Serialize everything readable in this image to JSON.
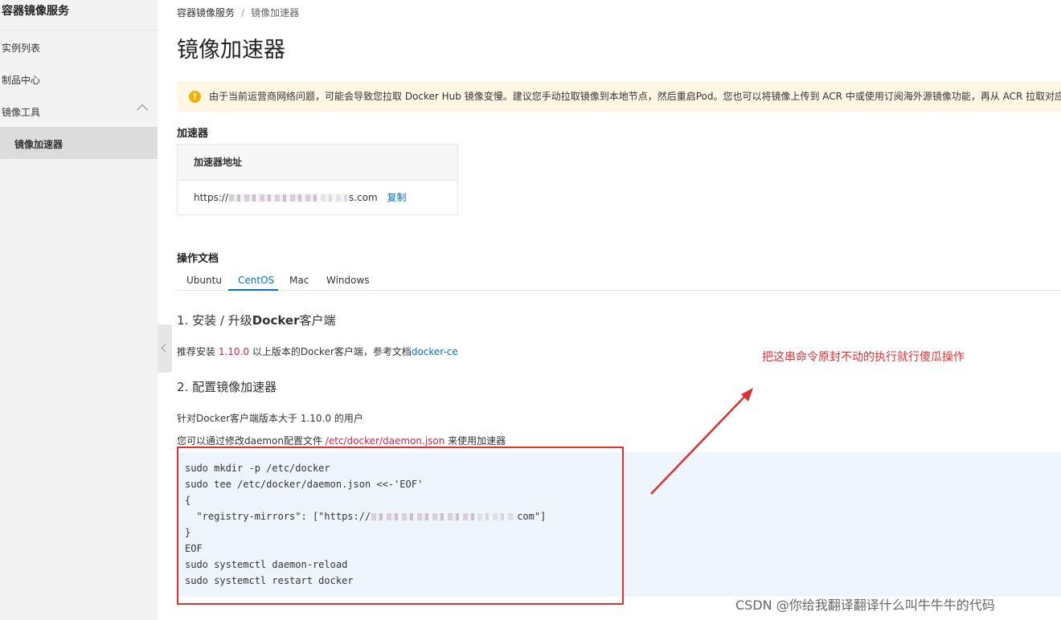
{
  "sidebar": {
    "title": "容器镜像服务",
    "items": [
      {
        "label": "实例列表"
      },
      {
        "label": "制品中心"
      },
      {
        "label": "镜像工具"
      },
      {
        "label": "镜像加速器"
      }
    ]
  },
  "breadcrumb": {
    "root": "容器镜像服务",
    "sep": "/",
    "current": "镜像加速器"
  },
  "page_title": "镜像加速器",
  "notice": "由于当前运营商网络问题，可能会导致您拉取 Docker Hub 镜像变慢。建议您手动拉取镜像到本地节点，然后重启Pod。您也可以将镜像上传到 ACR 中或使用订阅海外源镜像功能，再从 ACR 拉取对应镜",
  "accelerator": {
    "section_title": "加速器",
    "header": "加速器地址",
    "address_prefix": "https://",
    "address_suffix": "s.com",
    "copy_label": "复制"
  },
  "docs": {
    "section_title": "操作文档",
    "tabs": [
      "Ubuntu",
      "CentOS",
      "Mac",
      "Windows"
    ],
    "step1_num": "1. ",
    "step1_text": "安装 / 升级",
    "step1_bold": "Docker",
    "step1_tail": "客户端",
    "step1_desc_pre": "推荐安装 ",
    "step1_version": "1.10.0",
    "step1_desc_mid": " 以上版本的Docker客户端，参考文档",
    "step1_link": "docker-ce",
    "step2_title": "2. 配置镜像加速器",
    "step2_desc1": "针对Docker客户端版本大于 1.10.0 的用户",
    "step2_desc2_pre": "您可以通过修改daemon配置文件 ",
    "step2_path": "/etc/docker/daemon.json",
    "step2_desc2_post": " 来使用加速器",
    "code_lines": [
      "sudo mkdir -p /etc/docker",
      "sudo tee /etc/docker/daemon.json <<-'EOF'",
      "{",
      "  \"registry-mirrors\": [\"https://",
      "com\"]",
      "}",
      "EOF",
      "sudo systemctl daemon-reload",
      "sudo systemctl restart docker"
    ]
  },
  "annotation": "把这串命令原封不动的执行就行傻瓜操作",
  "watermark": "CSDN @你给我翻译翻译什么叫牛牛牛的代码",
  "colors": {
    "accent": "#0070cc",
    "annotation": "#e03030",
    "notice_bg": "#fff6e3"
  }
}
